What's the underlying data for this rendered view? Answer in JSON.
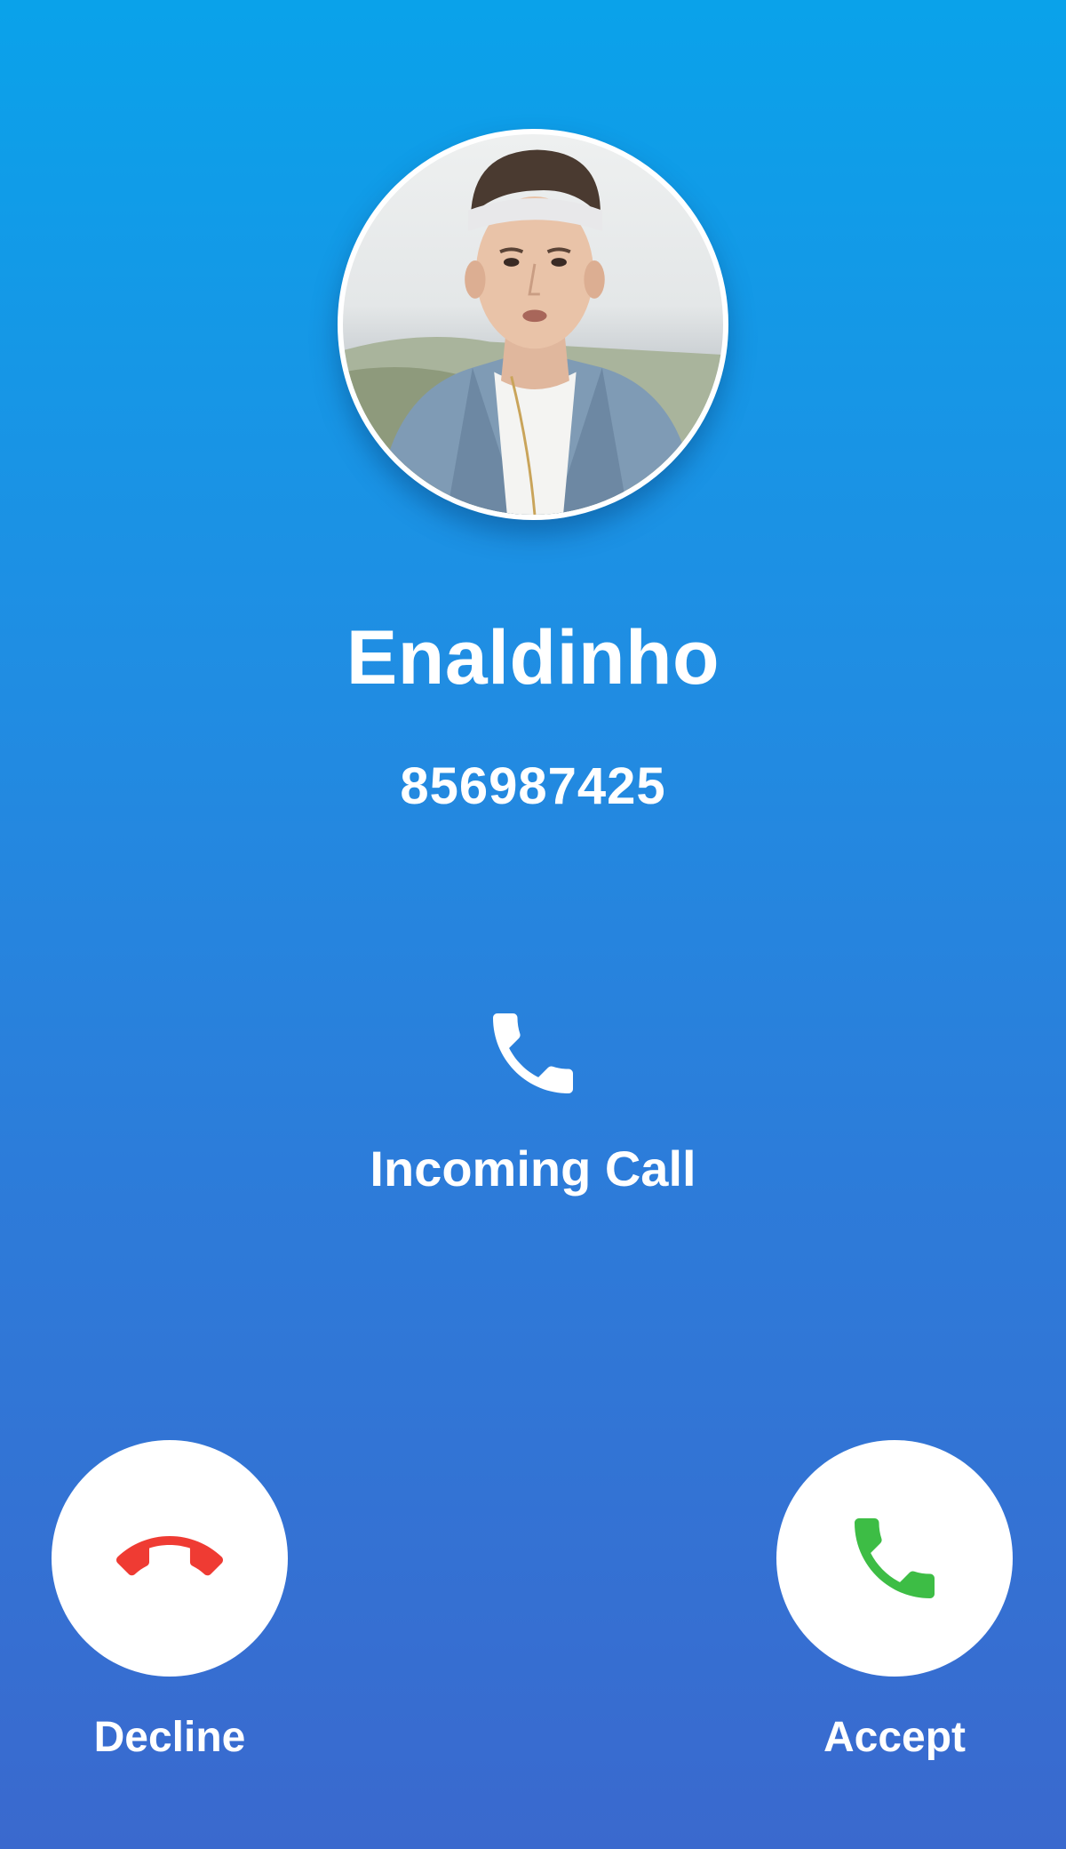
{
  "caller": {
    "name": "Enaldinho",
    "number": "856987425"
  },
  "status": {
    "label": "Incoming Call",
    "icon": "phone-icon"
  },
  "actions": {
    "decline": {
      "label": "Decline",
      "icon": "phone-hangup-icon",
      "color": "#ef3b33"
    },
    "accept": {
      "label": "Accept",
      "icon": "phone-icon",
      "color": "#3dbd45"
    }
  },
  "colors": {
    "background_top": "#0aa2ea",
    "background_bottom": "#3a69ce",
    "text": "#ffffff"
  }
}
